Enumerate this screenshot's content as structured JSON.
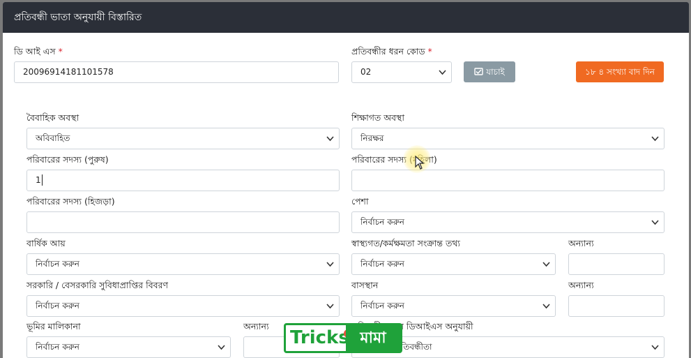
{
  "header": {
    "title": "প্রতিবন্ধী ভাতা অনুযায়ী বিস্তারিত"
  },
  "dis": {
    "label": "ডি আই এস",
    "required": "*",
    "value": "20096914181101578"
  },
  "disability_code": {
    "label": "প্রতিবন্ধীর ধরন কোড",
    "required": "*",
    "value": "02"
  },
  "buttons": {
    "check": "যাচাই",
    "skip": "১৮ ৪ সংখ্যা বাদ দিন"
  },
  "marital": {
    "label": "বৈবাহিক অবস্থা",
    "value": "অবিবাহিত"
  },
  "education": {
    "label": "শিক্ষাগত অবস্থা",
    "value": "নিরক্ষর"
  },
  "family_male": {
    "label": "পরিবারের সদস্য (পুরুষ)",
    "value": "1"
  },
  "family_female": {
    "label": "পরিবারের সদস্য (মহিলা)",
    "value": ""
  },
  "family_hijra": {
    "label": "পরিবারের সদস্য (হিজড়া)",
    "value": ""
  },
  "occupation": {
    "label": "পেশা",
    "value": "নির্বাচন করুন"
  },
  "annual_income": {
    "label": "বার্ষিক আয়",
    "value": "নির্বাচন করুন"
  },
  "health": {
    "label": "স্বাস্থ্যগত/কর্মক্ষমতা সংক্রান্ত তথ্য",
    "value": "নির্বাচন করুন"
  },
  "health_other": {
    "label": "অন্যান্য",
    "value": ""
  },
  "benefits": {
    "label": "সরকারি / বেসরকারি সুবিধাপ্রাপ্তির বিবরণ",
    "value": "নির্বাচন করুন"
  },
  "residence": {
    "label": "বাসস্থান",
    "value": "নির্বাচন করুন"
  },
  "residence_other": {
    "label": "অন্যান্য",
    "value": ""
  },
  "land": {
    "label": "ভূমির মালিকানা",
    "value": "নির্বাচন করুন"
  },
  "land_other": {
    "label": "অন্যান্য",
    "value": ""
  },
  "disability_dis": {
    "label": "প্রতিবন্ধীর ধরন ডিআইএস অনুযায়ী",
    "value": "বহুমাত্রিক প্রতিবন্ধীতা"
  },
  "watermark": {
    "left": "Tricks",
    "right": "মামা"
  }
}
